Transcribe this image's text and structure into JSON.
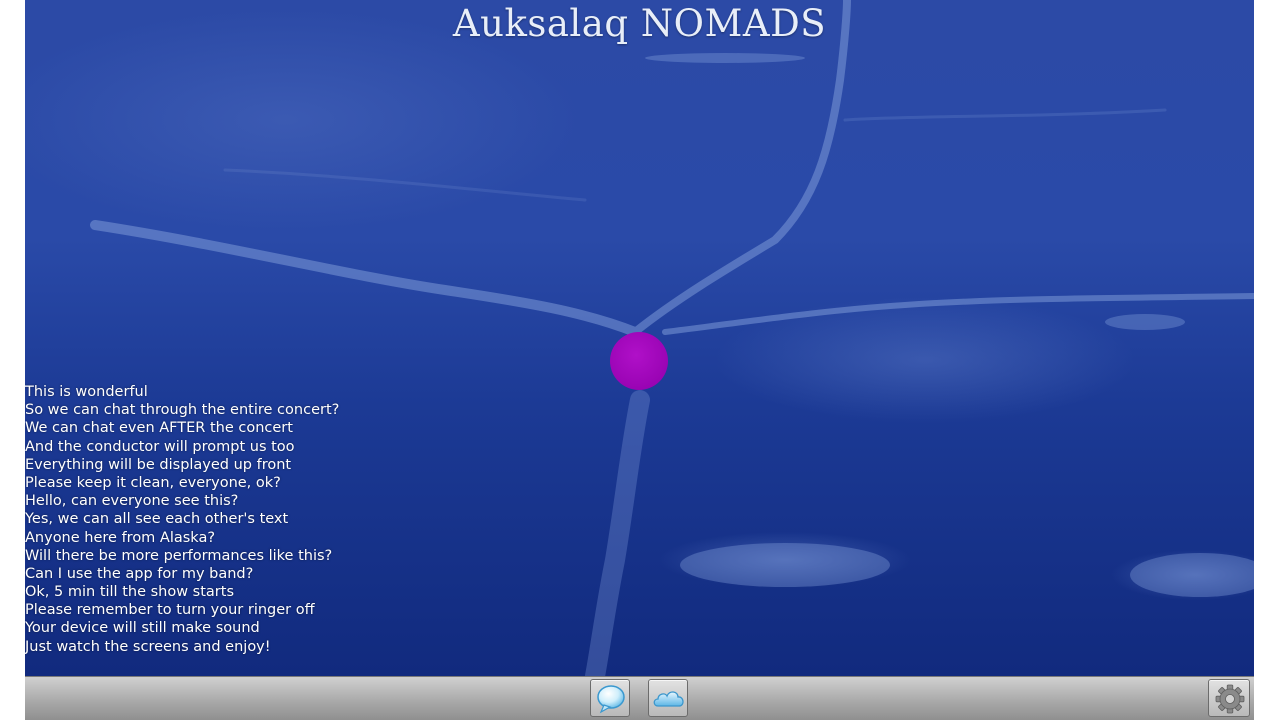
{
  "app": {
    "title": "Auksalaq NOMADS"
  },
  "chat": {
    "messages": [
      "This is wonderful",
      "So we can chat through the entire concert?",
      "We can chat even AFTER the concert",
      "And the conductor will prompt us too",
      "Everything will be displayed up front",
      "Please keep it clean, everyone, ok?",
      "Hello, can everyone see this?",
      "Yes, we can all see each other's text",
      "Anyone here from Alaska?",
      "Will there be more performances like this?",
      "Can I use the app for my band?",
      "Ok, 5 min till the show starts",
      "Please remember to turn your ringer off",
      "Your device will still make sound",
      "Just watch the screens and enjoy!"
    ]
  },
  "toolbar": {
    "buttons": [
      {
        "icon": "speech-bubble-icon"
      },
      {
        "icon": "cloud-icon"
      },
      {
        "icon": "gear-icon"
      }
    ]
  },
  "colors": {
    "background_ice": "#2a4aa8",
    "cursor_dot": "#9a04b4",
    "text": "#ffffff",
    "toolbar": "#a6a6a6"
  }
}
